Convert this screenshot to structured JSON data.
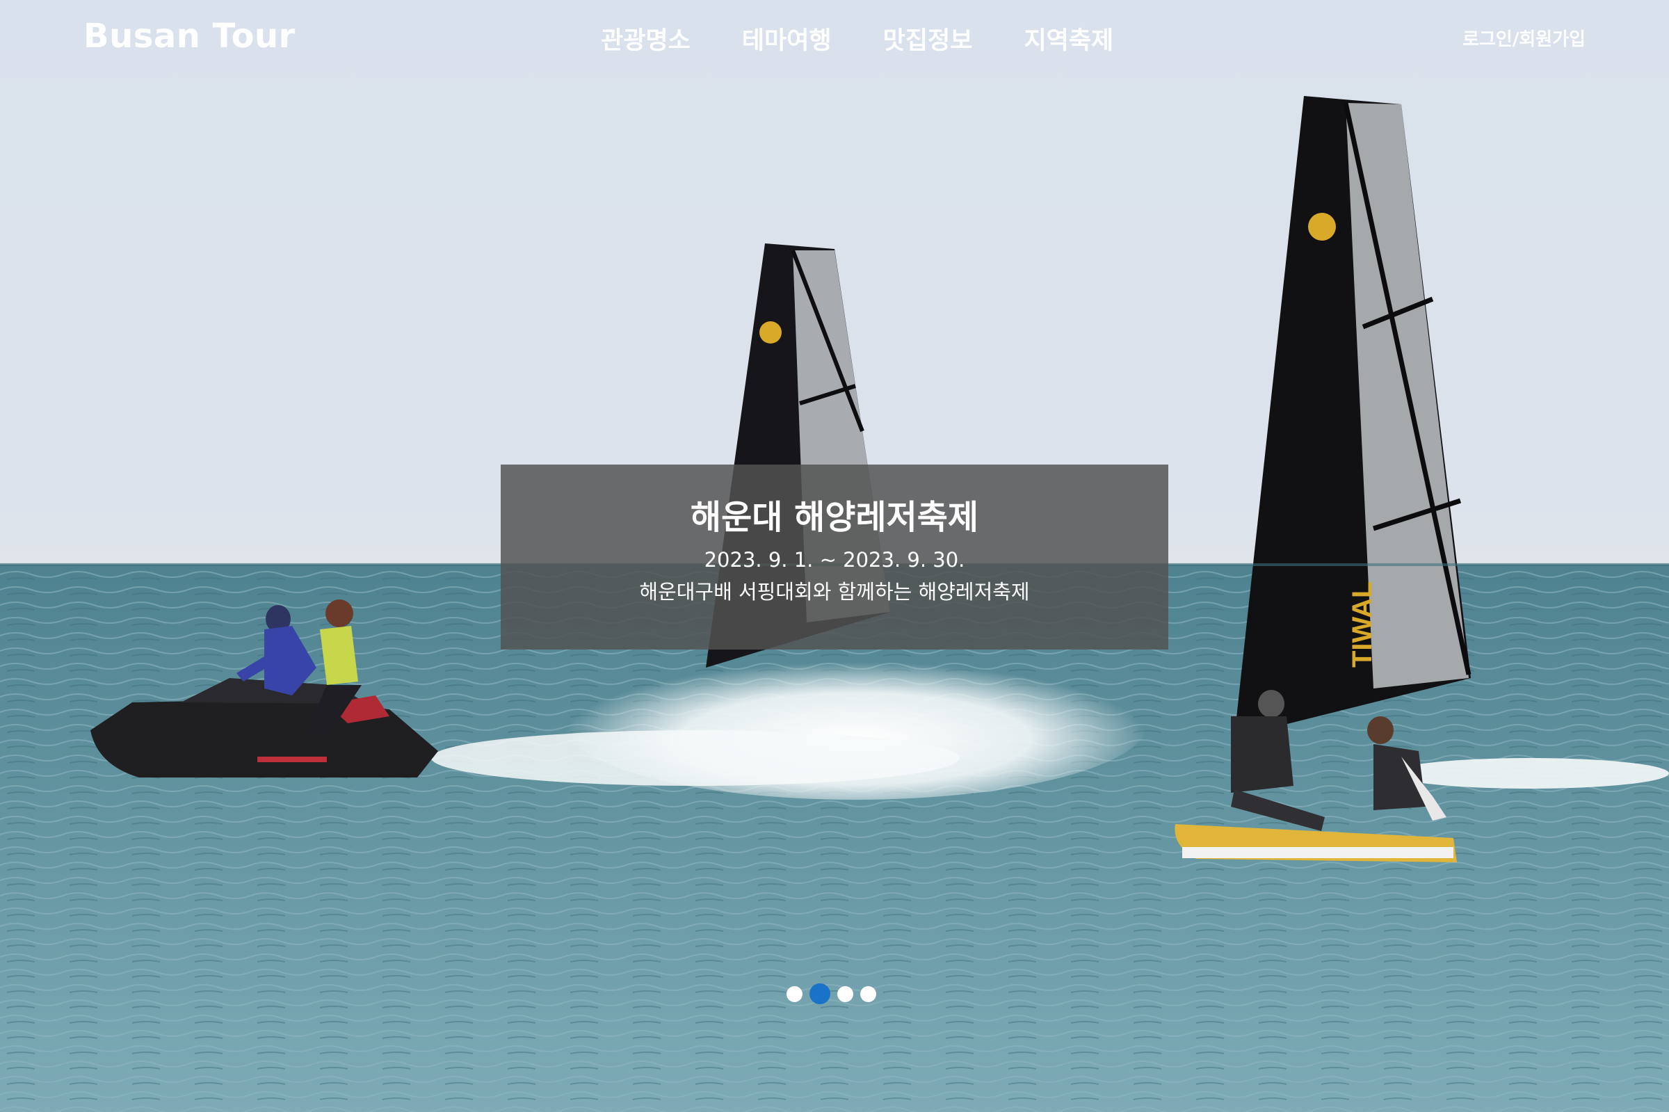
{
  "header": {
    "logo": "Busan Tour",
    "nav": [
      "관광명소",
      "테마여행",
      "맛집정보",
      "지역축제"
    ],
    "auth": "로그인/회원가입"
  },
  "slide": {
    "title": "해운대 해양레저축제",
    "date": "2023. 9. 1. ~ 2023. 9. 30.",
    "description": "해운대구배 서핑대회와 함께하는 해양레저축제"
  },
  "carousel": {
    "slide_count": 4,
    "active_index": 1,
    "active_color": "#1a73c9"
  },
  "photo": {
    "sail_brand": "TIWAL"
  }
}
